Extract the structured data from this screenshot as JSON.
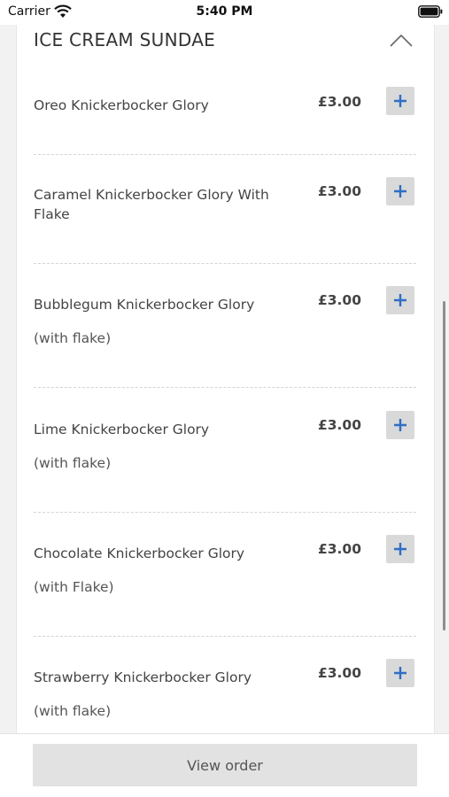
{
  "status_bar": {
    "carrier": "Carrier",
    "time": "5:40 PM",
    "wifi_icon": "wifi-icon",
    "battery_icon": "battery-icon"
  },
  "section": {
    "title": "ICE CREAM SUNDAE",
    "collapse_icon": "chevron-up-icon"
  },
  "items": [
    {
      "name": "Oreo Knickerbocker Glory",
      "description": "",
      "price": "£3.00"
    },
    {
      "name": "Caramel Knickerbocker Glory With Flake",
      "description": "",
      "price": "£3.00"
    },
    {
      "name": "Bubblegum Knickerbocker Glory",
      "description": "(with flake)",
      "price": "£3.00"
    },
    {
      "name": "Lime Knickerbocker Glory",
      "description": "(with flake)",
      "price": "£3.00"
    },
    {
      "name": "Chocolate Knickerbocker Glory",
      "description": "(with Flake)",
      "price": "£3.00"
    },
    {
      "name": "Strawberry Knickerbocker Glory",
      "description": "(with flake)",
      "price": "£3.00"
    }
  ],
  "add_icon": "plus-icon",
  "colors": {
    "accent": "#2f6fc4",
    "button_bg": "#d9d9d9",
    "footer_button_bg": "#e2e2e2"
  },
  "footer": {
    "view_order_label": "View order"
  }
}
